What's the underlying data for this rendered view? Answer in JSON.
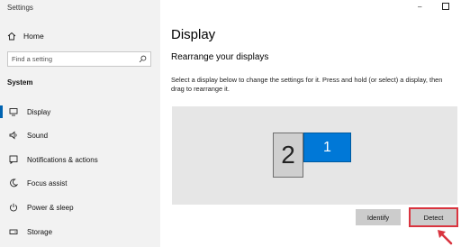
{
  "window": {
    "title": "Settings",
    "minimize": "–"
  },
  "sidebar": {
    "home_label": "Home",
    "search_placeholder": "Find a setting",
    "section": "System",
    "items": [
      {
        "label": "Display",
        "icon": "monitor-icon",
        "active": true
      },
      {
        "label": "Sound",
        "icon": "speaker-icon",
        "active": false
      },
      {
        "label": "Notifications & actions",
        "icon": "notification-icon",
        "active": false
      },
      {
        "label": "Focus assist",
        "icon": "moon-icon",
        "active": false
      },
      {
        "label": "Power & sleep",
        "icon": "power-icon",
        "active": false
      },
      {
        "label": "Storage",
        "icon": "storage-icon",
        "active": false
      }
    ]
  },
  "main": {
    "title": "Display",
    "subheading": "Rearrange your displays",
    "description": "Select a display below to change the settings for it. Press and hold (or select) a display, then drag to rearrange it.",
    "monitors": [
      {
        "number": "1",
        "primary": true
      },
      {
        "number": "2",
        "primary": false
      }
    ],
    "identify_label": "Identify",
    "detect_label": "Detect"
  },
  "colors": {
    "accent": "#0078d7",
    "highlight": "#d9343f",
    "sidebar_bg": "#f2f2f2",
    "arrange_bg": "#e6e6e6"
  }
}
